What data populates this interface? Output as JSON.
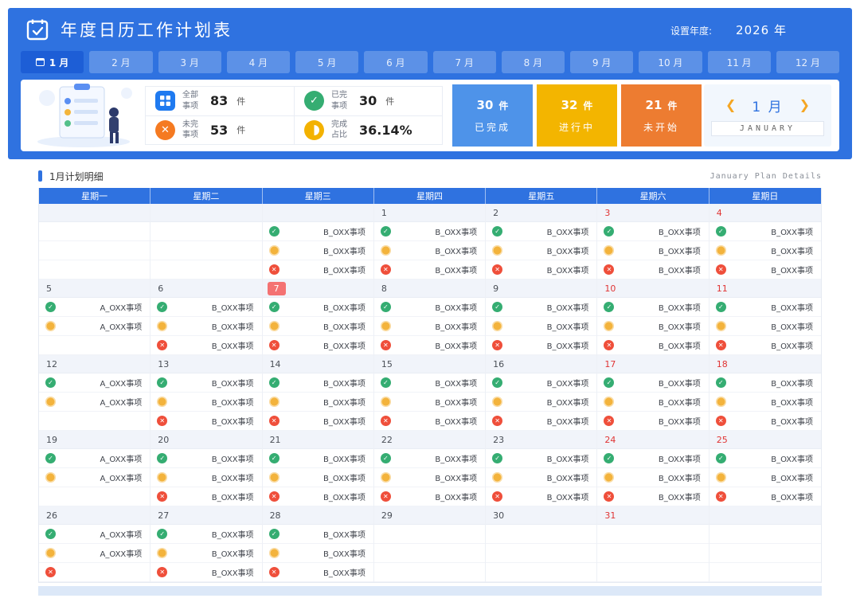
{
  "header": {
    "title": "年度日历工作计划表",
    "year_setting_label": "设置年度:",
    "year_value": "2026 年"
  },
  "tabs": [
    {
      "label": "1 月",
      "active": true
    },
    {
      "label": "2 月"
    },
    {
      "label": "3 月"
    },
    {
      "label": "4 月"
    },
    {
      "label": "5 月"
    },
    {
      "label": "6 月"
    },
    {
      "label": "7 月"
    },
    {
      "label": "8 月"
    },
    {
      "label": "9 月"
    },
    {
      "label": "10 月"
    },
    {
      "label": "11 月"
    },
    {
      "label": "12 月"
    }
  ],
  "stats": {
    "unit": "件",
    "all": {
      "label": "全部事项",
      "value": "83"
    },
    "done": {
      "label": "已完事项",
      "value": "30"
    },
    "undone": {
      "label": "未完事项",
      "value": "53"
    },
    "ratio": {
      "label": "完成占比",
      "value": "36.14%"
    },
    "tiles": [
      {
        "value": "30",
        "label": "已完成",
        "color": "#4e93e9"
      },
      {
        "value": "32",
        "label": "进行中",
        "color": "#f3b500"
      },
      {
        "value": "21",
        "label": "未开始",
        "color": "#ed7c31"
      }
    ],
    "month_nav": {
      "prev": "❮",
      "month": "1 月",
      "next": "❯",
      "subtitle": "JANUARY"
    }
  },
  "section": {
    "title": "1月计划明细",
    "subtitle": "January Plan Details"
  },
  "status_icons": {
    "done": "✓",
    "progress": "",
    "undone": "✕"
  },
  "calendar": {
    "weekdays": [
      "星期一",
      "星期二",
      "星期三",
      "星期四",
      "星期五",
      "星期六",
      "星期日"
    ],
    "weeks": [
      {
        "days": [
          {
            "num": "",
            "items": []
          },
          {
            "num": "",
            "items": []
          },
          {
            "num": "",
            "items": [
              {
                "s": "done",
                "t": "B_OXX事项"
              },
              {
                "s": "progress",
                "t": "B_OXX事项"
              },
              {
                "s": "undone",
                "t": "B_OXX事项"
              }
            ]
          },
          {
            "num": "1",
            "items": [
              {
                "s": "done",
                "t": "B_OXX事项"
              },
              {
                "s": "progress",
                "t": "B_OXX事项"
              },
              {
                "s": "undone",
                "t": "B_OXX事项"
              }
            ]
          },
          {
            "num": "2",
            "items": [
              {
                "s": "done",
                "t": "B_OXX事项"
              },
              {
                "s": "progress",
                "t": "B_OXX事项"
              },
              {
                "s": "undone",
                "t": "B_OXX事项"
              }
            ]
          },
          {
            "num": "3",
            "items": [
              {
                "s": "done",
                "t": "B_OXX事项"
              },
              {
                "s": "progress",
                "t": "B_OXX事项"
              },
              {
                "s": "undone",
                "t": "B_OXX事项"
              }
            ]
          },
          {
            "num": "4",
            "items": [
              {
                "s": "done",
                "t": "B_OXX事项"
              },
              {
                "s": "progress",
                "t": "B_OXX事项"
              },
              {
                "s": "undone",
                "t": "B_OXX事项"
              }
            ]
          }
        ]
      },
      {
        "days": [
          {
            "num": "5",
            "items": [
              {
                "s": "done",
                "t": "A_OXX事项"
              },
              {
                "s": "progress",
                "t": "A_OXX事项"
              }
            ]
          },
          {
            "num": "6",
            "items": [
              {
                "s": "done",
                "t": "B_OXX事项"
              },
              {
                "s": "progress",
                "t": "B_OXX事项"
              },
              {
                "s": "undone",
                "t": "B_OXX事项"
              }
            ]
          },
          {
            "num": "7",
            "today": true,
            "items": [
              {
                "s": "done",
                "t": "B_OXX事项"
              },
              {
                "s": "progress",
                "t": "B_OXX事项"
              },
              {
                "s": "undone",
                "t": "B_OXX事项"
              }
            ]
          },
          {
            "num": "8",
            "items": [
              {
                "s": "done",
                "t": "B_OXX事项"
              },
              {
                "s": "progress",
                "t": "B_OXX事项"
              },
              {
                "s": "undone",
                "t": "B_OXX事项"
              }
            ]
          },
          {
            "num": "9",
            "items": [
              {
                "s": "done",
                "t": "B_OXX事项"
              },
              {
                "s": "progress",
                "t": "B_OXX事项"
              },
              {
                "s": "undone",
                "t": "B_OXX事项"
              }
            ]
          },
          {
            "num": "10",
            "items": [
              {
                "s": "done",
                "t": "B_OXX事项"
              },
              {
                "s": "progress",
                "t": "B_OXX事项"
              },
              {
                "s": "undone",
                "t": "B_OXX事项"
              }
            ]
          },
          {
            "num": "11",
            "items": [
              {
                "s": "done",
                "t": "B_OXX事项"
              },
              {
                "s": "progress",
                "t": "B_OXX事项"
              },
              {
                "s": "undone",
                "t": "B_OXX事项"
              }
            ]
          }
        ]
      },
      {
        "days": [
          {
            "num": "12",
            "items": [
              {
                "s": "done",
                "t": "A_OXX事项"
              },
              {
                "s": "progress",
                "t": "A_OXX事项"
              }
            ]
          },
          {
            "num": "13",
            "items": [
              {
                "s": "done",
                "t": "B_OXX事项"
              },
              {
                "s": "progress",
                "t": "B_OXX事项"
              },
              {
                "s": "undone",
                "t": "B_OXX事项"
              }
            ]
          },
          {
            "num": "14",
            "items": [
              {
                "s": "done",
                "t": "B_OXX事项"
              },
              {
                "s": "progress",
                "t": "B_OXX事项"
              },
              {
                "s": "undone",
                "t": "B_OXX事项"
              }
            ]
          },
          {
            "num": "15",
            "items": [
              {
                "s": "done",
                "t": "B_OXX事项"
              },
              {
                "s": "progress",
                "t": "B_OXX事项"
              },
              {
                "s": "undone",
                "t": "B_OXX事项"
              }
            ]
          },
          {
            "num": "16",
            "items": [
              {
                "s": "done",
                "t": "B_OXX事项"
              },
              {
                "s": "progress",
                "t": "B_OXX事项"
              },
              {
                "s": "undone",
                "t": "B_OXX事项"
              }
            ]
          },
          {
            "num": "17",
            "items": [
              {
                "s": "done",
                "t": "B_OXX事项"
              },
              {
                "s": "progress",
                "t": "B_OXX事项"
              },
              {
                "s": "undone",
                "t": "B_OXX事项"
              }
            ]
          },
          {
            "num": "18",
            "items": [
              {
                "s": "done",
                "t": "B_OXX事项"
              },
              {
                "s": "progress",
                "t": "B_OXX事项"
              },
              {
                "s": "undone",
                "t": "B_OXX事项"
              }
            ]
          }
        ]
      },
      {
        "days": [
          {
            "num": "19",
            "items": [
              {
                "s": "done",
                "t": "A_OXX事项"
              },
              {
                "s": "progress",
                "t": "A_OXX事项"
              }
            ]
          },
          {
            "num": "20",
            "items": [
              {
                "s": "done",
                "t": "B_OXX事项"
              },
              {
                "s": "progress",
                "t": "B_OXX事项"
              },
              {
                "s": "undone",
                "t": "B_OXX事项"
              }
            ]
          },
          {
            "num": "21",
            "items": [
              {
                "s": "done",
                "t": "B_OXX事项"
              },
              {
                "s": "progress",
                "t": "B_OXX事项"
              },
              {
                "s": "undone",
                "t": "B_OXX事项"
              }
            ]
          },
          {
            "num": "22",
            "items": [
              {
                "s": "done",
                "t": "B_OXX事项"
              },
              {
                "s": "progress",
                "t": "B_OXX事项"
              },
              {
                "s": "undone",
                "t": "B_OXX事项"
              }
            ]
          },
          {
            "num": "23",
            "items": [
              {
                "s": "done",
                "t": "B_OXX事项"
              },
              {
                "s": "progress",
                "t": "B_OXX事项"
              },
              {
                "s": "undone",
                "t": "B_OXX事项"
              }
            ]
          },
          {
            "num": "24",
            "items": [
              {
                "s": "done",
                "t": "B_OXX事项"
              },
              {
                "s": "progress",
                "t": "B_OXX事项"
              },
              {
                "s": "undone",
                "t": "B_OXX事项"
              }
            ]
          },
          {
            "num": "25",
            "items": [
              {
                "s": "done",
                "t": "B_OXX事项"
              },
              {
                "s": "progress",
                "t": "B_OXX事项"
              },
              {
                "s": "undone",
                "t": "B_OXX事项"
              }
            ]
          }
        ]
      },
      {
        "days": [
          {
            "num": "26",
            "items": [
              {
                "s": "done",
                "t": "A_OXX事项"
              },
              {
                "s": "progress",
                "t": "A_OXX事项"
              },
              {
                "s": "undone",
                "t": ""
              }
            ]
          },
          {
            "num": "27",
            "items": [
              {
                "s": "done",
                "t": "B_OXX事项"
              },
              {
                "s": "progress",
                "t": "B_OXX事项"
              },
              {
                "s": "undone",
                "t": "B_OXX事项"
              }
            ]
          },
          {
            "num": "28",
            "items": [
              {
                "s": "done",
                "t": "B_OXX事项"
              },
              {
                "s": "progress",
                "t": "B_OXX事项"
              },
              {
                "s": "undone",
                "t": "B_OXX事项"
              }
            ]
          },
          {
            "num": "29",
            "items": []
          },
          {
            "num": "30",
            "items": []
          },
          {
            "num": "31",
            "items": []
          },
          {
            "num": "",
            "items": []
          }
        ]
      }
    ]
  }
}
